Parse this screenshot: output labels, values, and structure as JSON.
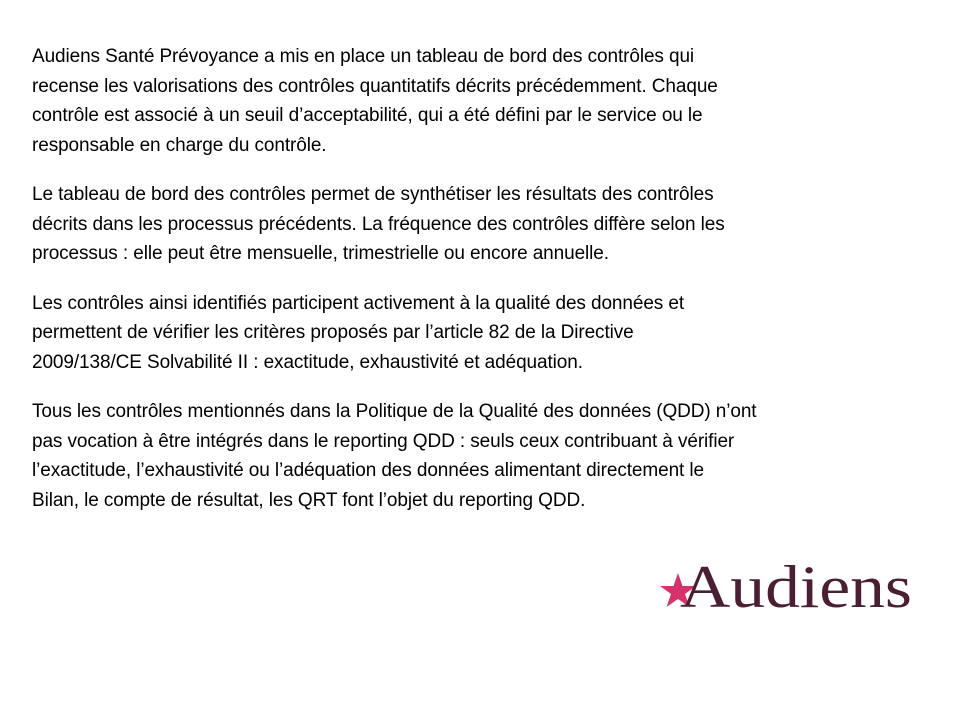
{
  "document": {
    "paragraphs": [
      {
        "lines": [
          "Audiens Santé Prévoyance a mis en place un tableau de bord des contrôles qui",
          "recense les valorisations des contrôles quantitatifs décrits précédemment. Chaque",
          "contrôle est associé à un seuil d’acceptabilité, qui a été défini par le service ou le",
          "responsable en charge du contrôle."
        ]
      },
      {
        "lines": [
          "Le tableau de bord des contrôles permet de synthétiser les résultats des contrôles",
          "décrits dans les processus précédents. La fréquence des contrôles diffère selon les",
          "processus : elle peut être mensuelle, trimestrielle ou encore annuelle."
        ]
      },
      {
        "lines": [
          "Les contrôles ainsi identifiés participent activement à la qualité des données et",
          "permettent de vérifier les critères proposés par l’article 82 de la Directive",
          "2009/138/CE  Solvabilité II : exactitude, exhaustivité et adéquation."
        ]
      },
      {
        "lines": [
          "Tous les contrôles mentionnés dans la Politique de la Qualité des données (QDD) n’ont",
          "pas vocation à être intégrés dans le reporting QDD : seuls ceux contribuant à vérifier",
          "l’exactitude, l’exhaustivité ou l’adéquation des données alimentant directement le",
          "Bilan, le compte de résultat, les QRT font l’objet du reporting QDD."
        ]
      }
    ]
  },
  "logo": {
    "text": "Audiens",
    "icon": "star-icon",
    "colors": {
      "star": "#d6336c",
      "text": "#4a1f33"
    }
  }
}
